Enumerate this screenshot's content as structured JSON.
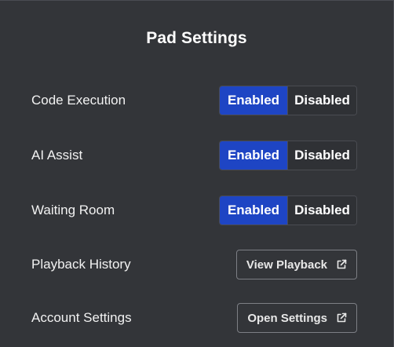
{
  "panel": {
    "title": "Pad Settings"
  },
  "settings": {
    "code_execution": {
      "label": "Code Execution",
      "enabled_label": "Enabled",
      "disabled_label": "Disabled",
      "selected": "Enabled"
    },
    "ai_assist": {
      "label": "AI Assist",
      "enabled_label": "Enabled",
      "disabled_label": "Disabled",
      "selected": "Enabled"
    },
    "waiting_room": {
      "label": "Waiting Room",
      "enabled_label": "Enabled",
      "disabled_label": "Disabled",
      "selected": "Enabled"
    },
    "playback_history": {
      "label": "Playback History",
      "button_label": "View Playback",
      "icon": "external-link-icon"
    },
    "account_settings": {
      "label": "Account Settings",
      "button_label": "Open Settings",
      "icon": "external-link-icon"
    }
  },
  "colors": {
    "background": "#333539",
    "accent": "#1e45c4",
    "toggle_off": "#2f3135",
    "border": "#4a4c52"
  }
}
